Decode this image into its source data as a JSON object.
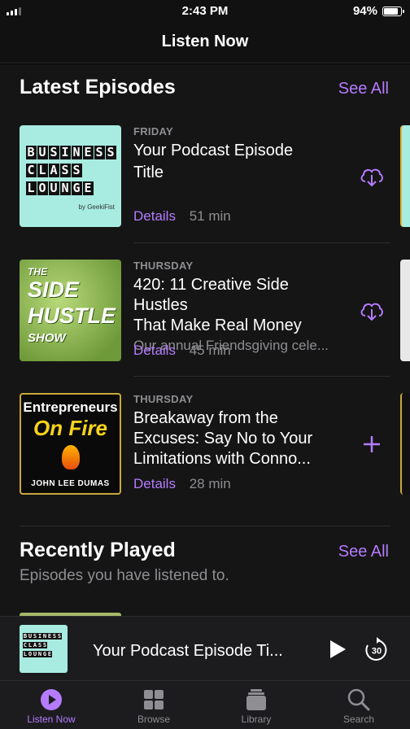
{
  "status": {
    "time": "2:43 PM",
    "battery": "94%"
  },
  "nav": {
    "title": "Listen Now"
  },
  "latest": {
    "title": "Latest Episodes",
    "see_all": "See All",
    "episodes": [
      {
        "day": "FRIDAY",
        "title_line1": "Your Podcast Episode",
        "title_line2": "Title",
        "details": "Details",
        "duration": "51 min",
        "action": "download-icon",
        "art": {
          "line1": "BUSINESS",
          "line2": "CLASS",
          "line3": "LOUNGE",
          "by": "by GeekiFist"
        }
      },
      {
        "day": "THURSDAY",
        "title_line1": "420: 11 Creative Side Hustles",
        "title_line2": "That Make Real Money",
        "description": "Our annual Friendsgiving cele...",
        "details": "Details",
        "duration": "45 min",
        "action": "download-icon",
        "art": {
          "line1": "THE",
          "line2": "SIDE",
          "line3": "HUSTLE",
          "line4": "SHOW"
        }
      },
      {
        "day": "THURSDAY",
        "title_line1": "Breakaway from the",
        "title_line2": "Excuses: Say No to Your",
        "title_line3": "Limitations with Conno...",
        "details": "Details",
        "duration": "28 min",
        "action": "plus-icon",
        "art": {
          "line1": "Entrepreneurs",
          "line2": "On Fire",
          "line3": "JOHN LEE DUMAS"
        }
      }
    ]
  },
  "recent": {
    "title": "Recently Played",
    "see_all": "See All",
    "subtitle": "Episodes you have listened to."
  },
  "mini_player": {
    "title": "Your Podcast Episode  Ti...",
    "skip_label": "30",
    "art": {
      "line1": "BUSINESS",
      "line2": "CLASS",
      "line3": "LOUNGE"
    }
  },
  "tabs": [
    {
      "label": "Listen Now",
      "icon": "play-circle-icon",
      "active": true
    },
    {
      "label": "Browse",
      "icon": "grid-icon",
      "active": false
    },
    {
      "label": "Library",
      "icon": "stack-icon",
      "active": false
    },
    {
      "label": "Search",
      "icon": "search-icon",
      "active": false
    }
  ],
  "colors": {
    "accent": "#b57bff",
    "background": "#151515",
    "secondary_text": "#8e8e93"
  }
}
